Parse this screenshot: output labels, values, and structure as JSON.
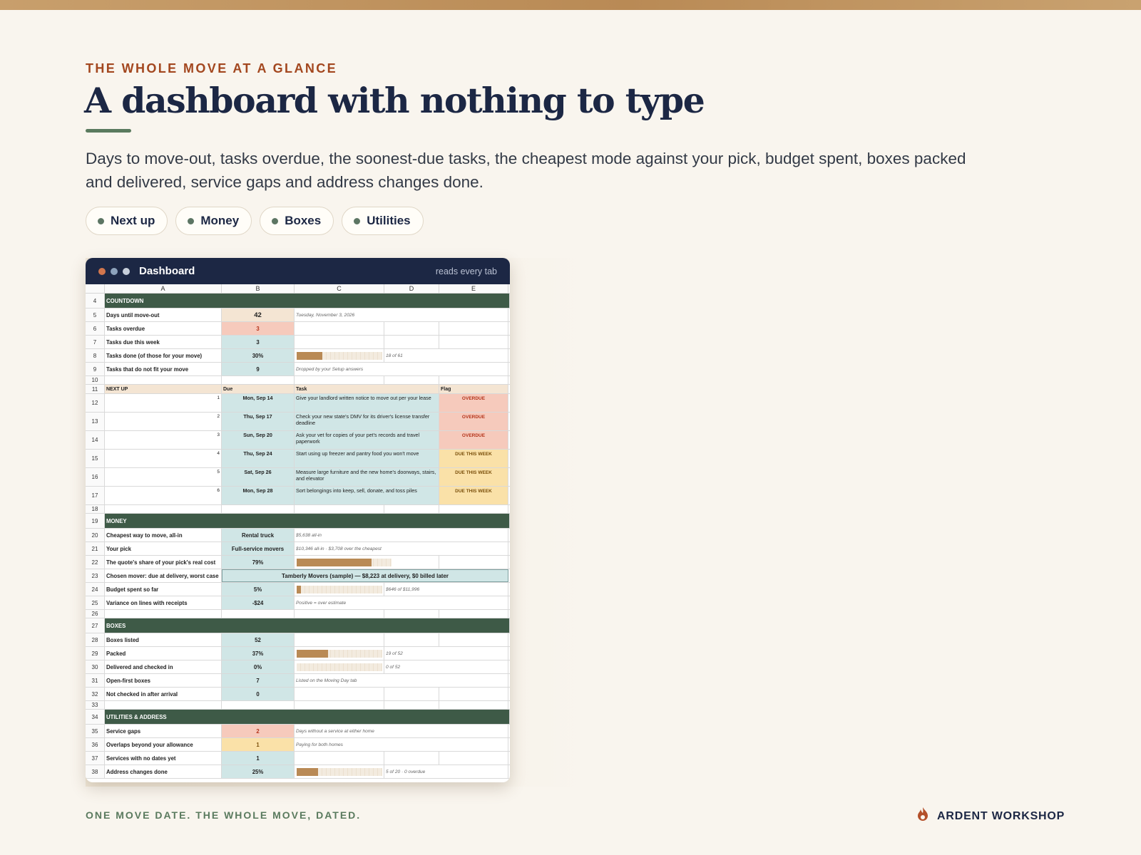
{
  "eyebrow": "THE WHOLE MOVE AT A GLANCE",
  "title": "A dashboard with nothing to type",
  "description": "Days to move-out, tasks overdue, the soonest-due tasks, the cheapest mode against your pick, budget spent, boxes packed and delivered, service gaps and address changes done.",
  "chips": [
    "Next up",
    "Money",
    "Boxes",
    "Utilities"
  ],
  "card": {
    "title": "Dashboard",
    "note": "reads every tab",
    "dot_colors": [
      "#d2764d",
      "#8ea3bc",
      "#c7cfdb"
    ]
  },
  "sheet": {
    "columns": [
      "A",
      "B",
      "C",
      "D",
      "E"
    ],
    "countdown": {
      "header": "COUNTDOWN",
      "days_label": "Days until move-out",
      "days_value": "42",
      "days_note": "Tuesday, November 3, 2026",
      "overdue_label": "Tasks overdue",
      "overdue_value": "3",
      "week_label": "Tasks due this week",
      "week_value": "3",
      "done_label": "Tasks done (of those for your move)",
      "done_value": "30%",
      "done_fraction": 0.3,
      "done_note": "18 of 61",
      "unfit_label": "Tasks that do not fit your move",
      "unfit_value": "9",
      "unfit_note": "Dropped by your Setup answers"
    },
    "nextup": {
      "header": "NEXT UP",
      "due_header": "Due",
      "task_header": "Task",
      "flag_header": "Flag",
      "rows": [
        {
          "n": "1",
          "due": "Mon, Sep 14",
          "task": "Give your landlord written notice to move out per your lease",
          "flag": "OVERDUE",
          "kind": "overdue"
        },
        {
          "n": "2",
          "due": "Thu, Sep 17",
          "task": "Check your new state's DMV for its driver's license transfer deadline",
          "flag": "OVERDUE",
          "kind": "overdue"
        },
        {
          "n": "3",
          "due": "Sun, Sep 20",
          "task": "Ask your vet for copies of your pet's records and travel paperwork",
          "flag": "OVERDUE",
          "kind": "overdue"
        },
        {
          "n": "4",
          "due": "Thu, Sep 24",
          "task": "Start using up freezer and pantry food you won't move",
          "flag": "DUE THIS WEEK",
          "kind": "week"
        },
        {
          "n": "5",
          "due": "Sat, Sep 26",
          "task": "Measure large furniture and the new home's doorways, stairs, and elevator",
          "flag": "DUE THIS WEEK",
          "kind": "week"
        },
        {
          "n": "6",
          "due": "Mon, Sep 28",
          "task": "Sort belongings into keep, sell, donate, and toss piles",
          "flag": "DUE THIS WEEK",
          "kind": "week"
        }
      ]
    },
    "money": {
      "header": "MONEY",
      "cheapest_label": "Cheapest way to move, all-in",
      "cheapest_value": "Rental truck",
      "cheapest_note": "$5,638 all-in",
      "pick_label": "Your pick",
      "pick_value": "Full-service movers",
      "pick_note": "$10,346 all-in · $3,708 over the cheapest",
      "share_label": "The quote's share of your pick's real cost",
      "share_value": "79%",
      "share_fraction": 0.79,
      "mover_label": "Chosen mover: due at delivery, worst case",
      "mover_value": "Tamberly Movers (sample)  —  $8,223 at delivery, $0 billed later",
      "budget_label": "Budget spent so far",
      "budget_value": "5%",
      "budget_fraction": 0.05,
      "budget_note": "$646 of $11,996",
      "variance_label": "Variance on lines with receipts",
      "variance_value": "-$24",
      "variance_note": "Positive = over estimate"
    },
    "boxes": {
      "header": "BOXES",
      "listed_label": "Boxes listed",
      "listed_value": "52",
      "packed_label": "Packed",
      "packed_value": "37%",
      "packed_fraction": 0.37,
      "packed_note": "19 of 52",
      "delivered_label": "Delivered and checked in",
      "delivered_value": "0%",
      "delivered_fraction": 0,
      "delivered_note": "0 of 52",
      "openfirst_label": "Open-first boxes",
      "openfirst_value": "7",
      "openfirst_note": "Listed on the Moving Day tab",
      "notchecked_label": "Not checked in after arrival",
      "notchecked_value": "0"
    },
    "utilities": {
      "header": "UTILITIES & ADDRESS",
      "gaps_label": "Service gaps",
      "gaps_value": "2",
      "gaps_note": "Days without a service at either home",
      "overlaps_label": "Overlaps beyond your allowance",
      "overlaps_value": "1",
      "overlaps_note": "Paying for both homes",
      "nodates_label": "Services with no dates yet",
      "nodates_value": "1",
      "address_label": "Address changes done",
      "address_value": "25%",
      "address_fraction": 0.25,
      "address_note": "5 of 20 · 0 overdue"
    }
  },
  "footer": {
    "tagline": "ONE MOVE DATE. THE WHOLE MOVE, DATED.",
    "brand": "ARDENT WORKSHOP",
    "brand_icon": "flame-icon"
  }
}
